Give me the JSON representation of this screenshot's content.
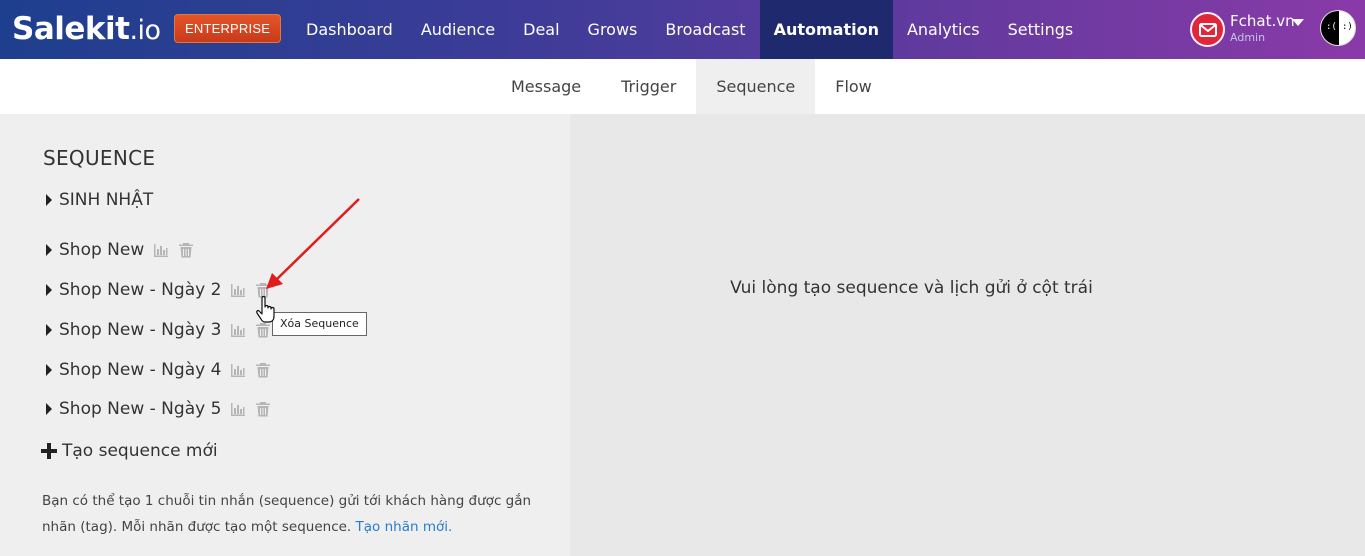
{
  "navbar": {
    "logo_main": "Salekit",
    "logo_tld": ".io",
    "plan_badge": "ENTERPRISE",
    "items": [
      {
        "label": "Dashboard"
      },
      {
        "label": "Audience"
      },
      {
        "label": "Deal"
      },
      {
        "label": "Grows"
      },
      {
        "label": "Broadcast"
      },
      {
        "label": "Automation",
        "active": true
      },
      {
        "label": "Analytics"
      },
      {
        "label": "Settings"
      }
    ],
    "user": {
      "name": "Fchat.vn",
      "role": "Admin"
    },
    "theme_toggle": {
      "left_face": ":(",
      "right_face": ":)"
    }
  },
  "subtabs": [
    {
      "label": "Message"
    },
    {
      "label": "Trigger"
    },
    {
      "label": "Sequence",
      "active": true
    },
    {
      "label": "Flow"
    }
  ],
  "sidebar": {
    "title": "SEQUENCE",
    "items": [
      {
        "label": "SINH NHẬT",
        "has_tools": false
      },
      {
        "label": "Shop New",
        "has_tools": true
      },
      {
        "label": "Shop New - Ngày 2",
        "has_tools": true
      },
      {
        "label": "Shop New - Ngày 3",
        "has_tools": true
      },
      {
        "label": "Shop New - Ngày 4",
        "has_tools": true
      },
      {
        "label": "Shop New - Ngày 5",
        "has_tools": true
      }
    ],
    "add_label": "Tạo sequence mới",
    "help_text": "Bạn có thể tạo 1 chuỗi tin nhắn (sequence) gửi tới khách hàng được gắn nhãn (tag). Mỗi nhãn được tạo một sequence.",
    "help_link": "Tạo nhãn mới."
  },
  "main": {
    "placeholder": "Vui lòng tạo sequence và lịch gửi ở cột trái"
  },
  "tooltip": "Xóa Sequence",
  "colors": {
    "brand_gradient_start": "#1e3f8e",
    "brand_gradient_end": "#8a3aa8",
    "active_nav": "#1f2a6e",
    "badge": "#d8452a",
    "link": "#2b7bd1",
    "annotation_arrow": "#e21b1b"
  }
}
